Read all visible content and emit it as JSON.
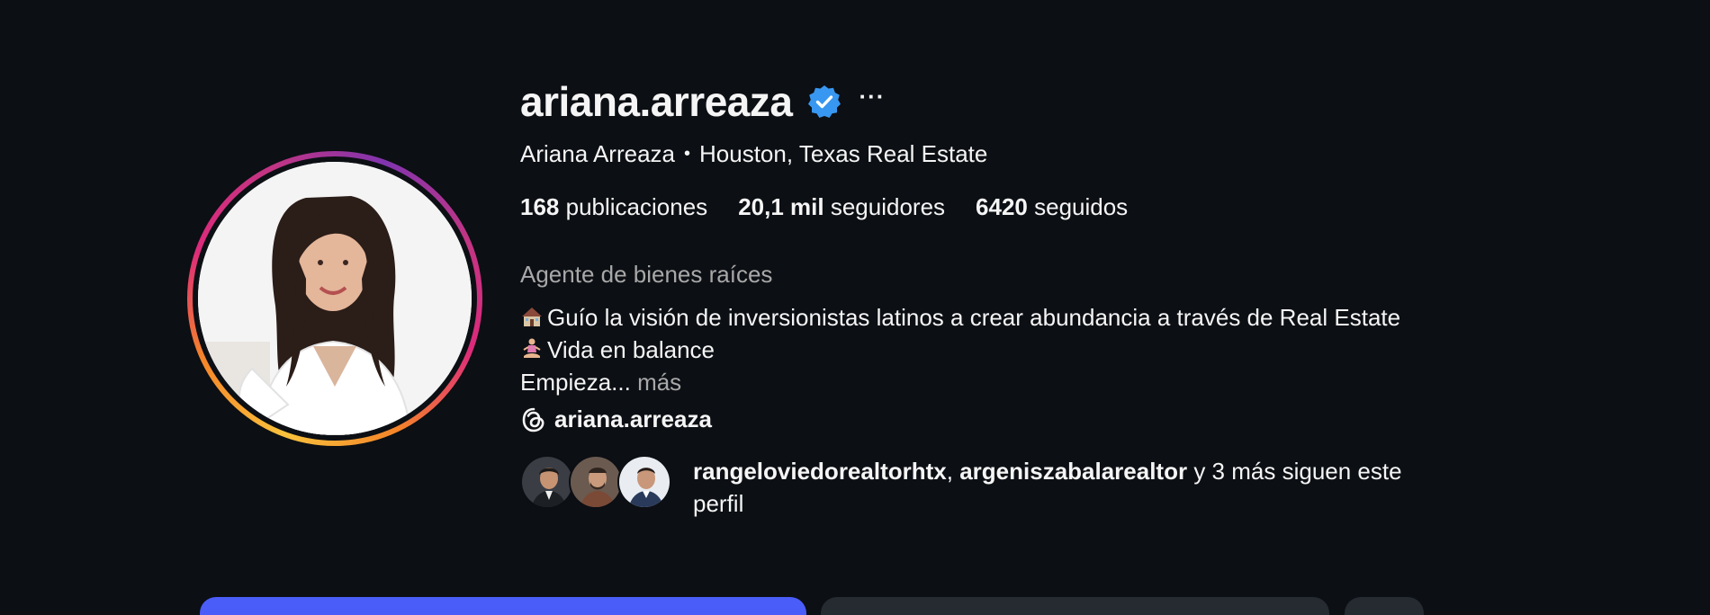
{
  "profile": {
    "username": "ariana.arreaza",
    "full_name": "Ariana Arreaza",
    "separator": "•",
    "subtitle": "Houston, Texas Real Estate",
    "more_icon": "···"
  },
  "stats": {
    "posts_count": "168",
    "posts_label": "publicaciones",
    "followers_count": "20,1 mil",
    "followers_label": "seguidores",
    "following_count": "6420",
    "following_label": "seguidos"
  },
  "bio": {
    "category": "Agente de bienes raíces",
    "line1": "Guío la visión de inversionistas latinos a crear abundancia a través de Real Estate",
    "line2": "Vida en balance",
    "line3": "Empieza...",
    "more_label": "más"
  },
  "threads": {
    "handle": "ariana.arreaza"
  },
  "followed_by": {
    "user1": "rangeloviedorealtorhtx",
    "comma": ",",
    "user2": "argeniszabalarealtor",
    "rest": "y 3 más siguen este perfil"
  },
  "colors": {
    "background": "#0c0f14",
    "primary_button": "#4a5df9",
    "secondary_button": "#262a31",
    "verified": "#3897f0",
    "muted_text": "#a8a8a8"
  },
  "icons": {
    "verified": "verified-badge-icon",
    "more": "more-options-icon",
    "threads": "threads-icon",
    "house_emoji": "house-emoji-icon",
    "yoga_emoji": "yoga-emoji-icon"
  }
}
